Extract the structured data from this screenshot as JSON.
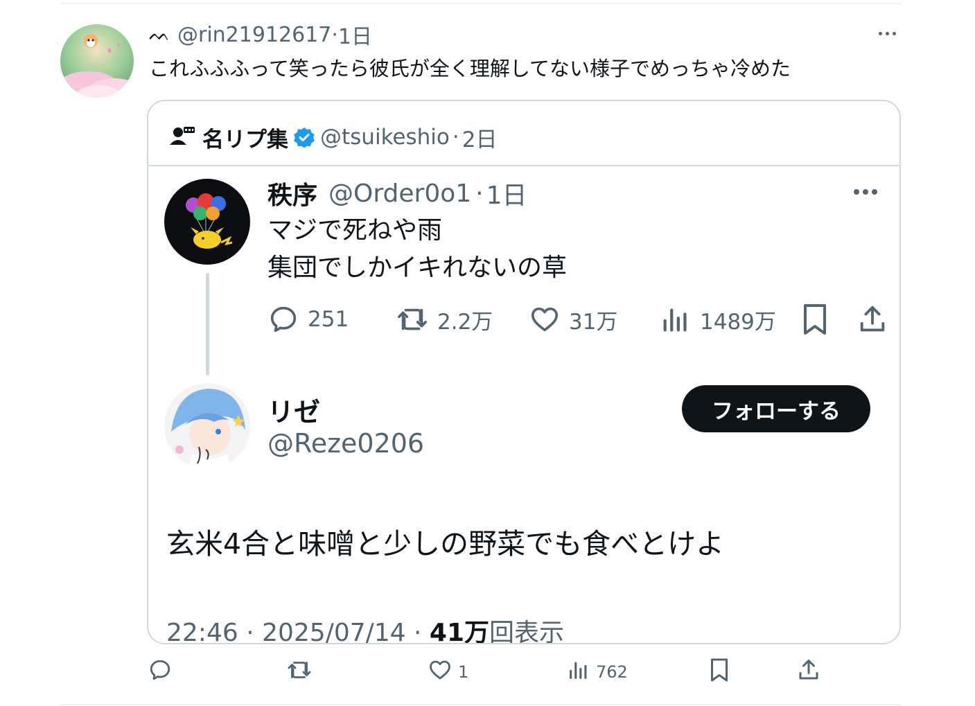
{
  "outer_tweet": {
    "username_glyph": "ᨓ",
    "handle": "@rin21912617",
    "time": "1日",
    "text": "これふふふって笑ったら彼氏が全く理解してない様子でめっちゃ冷めた",
    "actions": {
      "reply_count": "",
      "retweet_count": "",
      "like_count": "1",
      "views_count": "762"
    }
  },
  "quote": {
    "account_name": "名リプ集",
    "verified": true,
    "handle": "@tsuikeshio",
    "time": "2日",
    "original_post": {
      "name": "秩序",
      "handle": "@Order0o1",
      "time": "1日",
      "lines": [
        "マジで死ねや雨",
        "集団でしかイキれないの草"
      ],
      "actions": {
        "reply_count": "251",
        "retweet_count": "2.2万",
        "like_count": "31万",
        "views_count": "1489万"
      }
    },
    "reply": {
      "name": "リゼ",
      "handle": "@Reze0206",
      "follow_label": "フォローする",
      "text": "玄米4合と味噌と少しの野菜でも食べとけよ",
      "timestamp": "22:46 · 2025/07/14 · ",
      "views_bold": "41万",
      "views_suffix": "回表示"
    }
  },
  "colors": {
    "text": "#0f1419",
    "secondary": "#536471",
    "border": "#cfd9de",
    "verified_blue": "#1d9bf0",
    "button_bg": "#0f1419"
  }
}
